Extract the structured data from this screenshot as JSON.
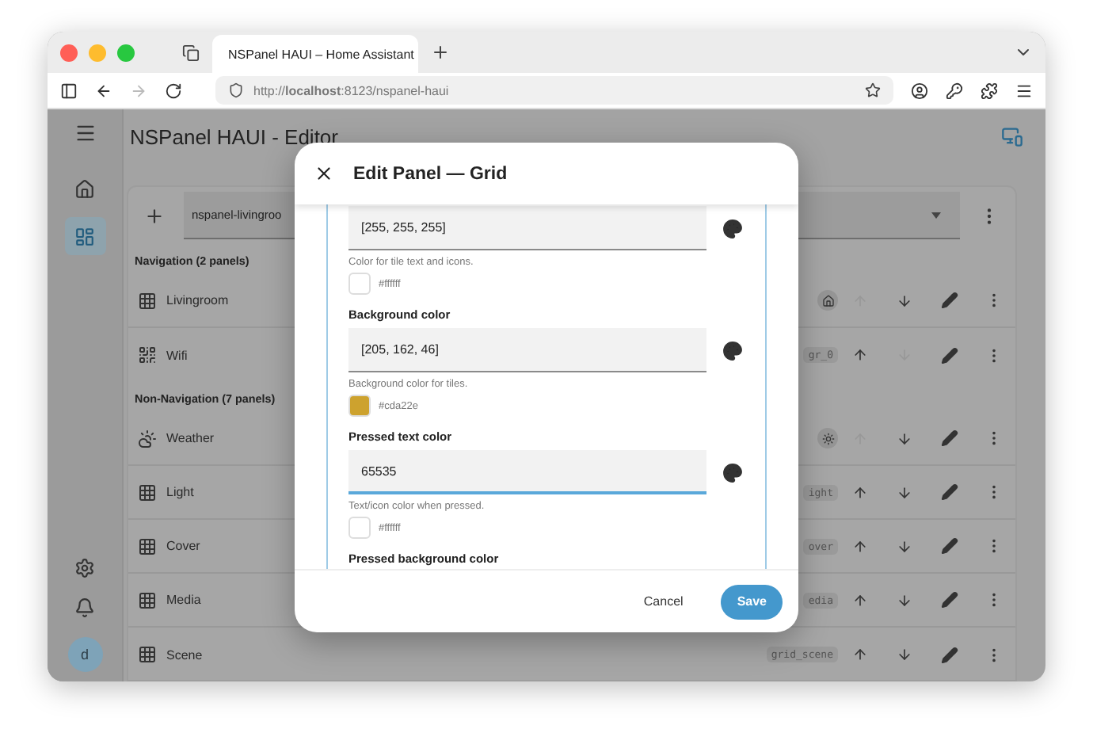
{
  "browser": {
    "tab_title": "NSPanel HAUI – Home Assistant",
    "url": "http://**localhost**:8123/nspanel-haui",
    "nav": [
      {
        "kind": "back",
        "disabled": false
      },
      {
        "kind": "forward",
        "disabled": true
      },
      {
        "kind": "reload",
        "disabled": false
      }
    ]
  },
  "app": {
    "title": "NSPanel HAUI - Editor",
    "sidebar": {
      "items": [
        {
          "kind": "home",
          "selected": false
        },
        {
          "kind": "panels",
          "selected": true
        }
      ],
      "avatar": "d"
    },
    "device_select": {
      "value": "nspanel-livingroo"
    },
    "sections": [
      {
        "title": "Navigation (2 panels)",
        "panels": [
          {
            "kind": "grid",
            "name": "Livingroom",
            "badge": {
              "kind": "home"
            },
            "up_disabled": true,
            "down_disabled": false
          },
          {
            "kind": "qr",
            "name": "Wifi",
            "badge": {
              "kind": "text",
              "text": "gr_0"
            },
            "up_disabled": false,
            "down_disabled": true
          }
        ]
      },
      {
        "title": "Non-Navigation (7 panels)",
        "panels": [
          {
            "kind": "weather",
            "name": "Weather",
            "badge": {
              "kind": "weather"
            },
            "up_disabled": true,
            "down_disabled": false
          },
          {
            "kind": "grid",
            "name": "Light",
            "badge": {
              "kind": "text",
              "text": "ight"
            },
            "up_disabled": false,
            "down_disabled": false
          },
          {
            "kind": "grid",
            "name": "Cover",
            "badge": {
              "kind": "text",
              "text": "over"
            },
            "up_disabled": false,
            "down_disabled": false
          },
          {
            "kind": "grid",
            "name": "Media",
            "badge": {
              "kind": "text",
              "text": "edia"
            },
            "up_disabled": false,
            "down_disabled": false
          },
          {
            "kind": "grid",
            "name": "Scene",
            "badge": {
              "kind": "text",
              "text": "grid_scene"
            },
            "up_disabled": false,
            "down_disabled": false
          }
        ]
      }
    ]
  },
  "dialog": {
    "title": "Edit Panel — Grid",
    "fields": [
      {
        "value": "[255, 255, 255]",
        "focused": false,
        "helper": "Color for tile text and icons.",
        "swatch": {
          "color": "#ffffff",
          "text": "#ffffff"
        }
      },
      {
        "label": "Background color",
        "value": "[205, 162, 46]",
        "focused": false,
        "helper": "Background color for tiles.",
        "swatch": {
          "color": "#cda22e",
          "text": "#cda22e"
        }
      },
      {
        "label": "Pressed text color",
        "value": "65535",
        "focused": true,
        "helper": "Text/icon color when pressed.",
        "swatch": {
          "color": "#ffffff",
          "text": "#ffffff"
        }
      }
    ],
    "next_label": "Pressed background color",
    "buttons": [
      {
        "kind": "text",
        "label": "Cancel"
      },
      {
        "kind": "primary",
        "label": "Save"
      }
    ]
  }
}
